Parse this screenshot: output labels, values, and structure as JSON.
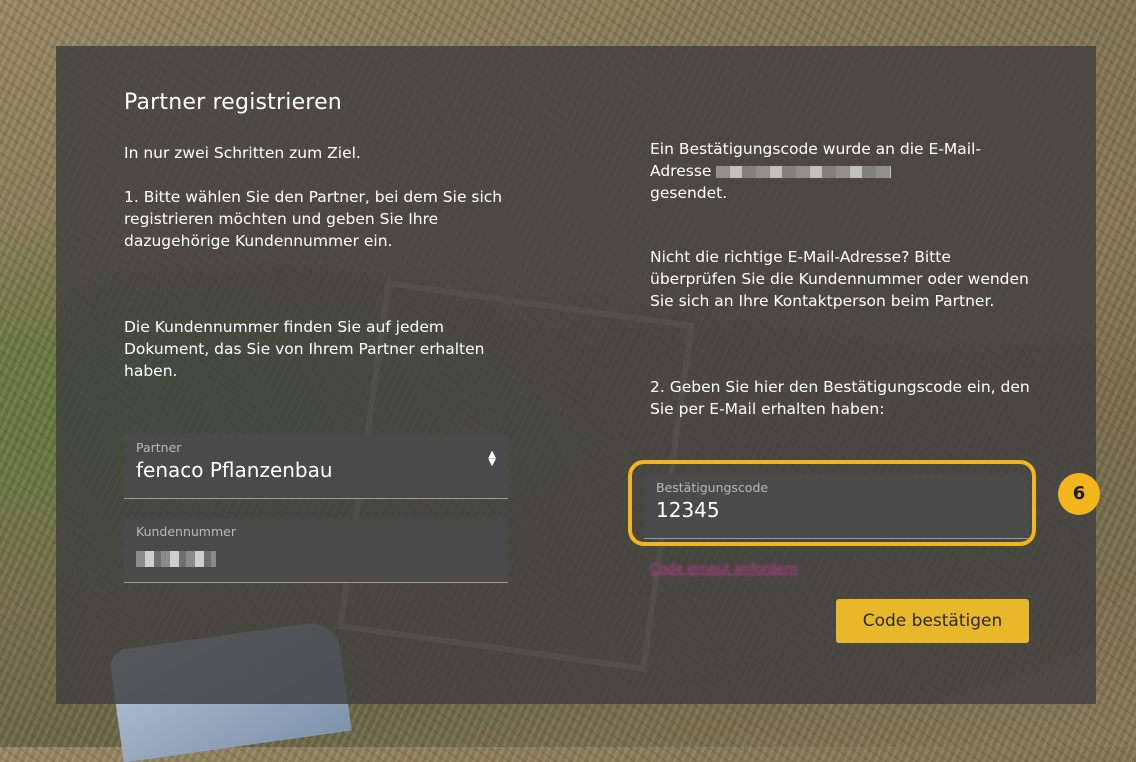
{
  "panel": {
    "title": "Partner registrieren",
    "subtitle": "In nur zwei Schritten zum Ziel.",
    "step1_text": "1. Bitte wählen Sie den Partner, bei dem Sie sich registrieren möchten und geben Sie Ihre dazugehörige Kundennummer ein.",
    "info_text": "Die Kundennummer finden Sie auf jedem Dokument, das Sie von Ihrem Partner erhalten haben."
  },
  "partner_select": {
    "label": "Partner",
    "value": "fenaco Pflanzenbau"
  },
  "customer_number": {
    "label": "Kundennummer"
  },
  "confirmation": {
    "sent_prefix": "Ein Bestätigungscode wurde an die E-Mail-Adresse",
    "sent_suffix": "gesendet.",
    "wrong_email_text": "Nicht die richtige E-Mail-Adresse? Bitte überprüfen Sie die Kundennummer oder wenden Sie sich an Ihre Kontaktperson beim Partner.",
    "step2_text": "2. Geben Sie hier den Bestätigungscode ein, den Sie per E-Mail erhalten haben:",
    "code_label": "Bestätigungscode",
    "code_value": "12345",
    "resend_link": "Code erneut anfordern",
    "confirm_button": "Code bestätigen"
  },
  "annotation": {
    "step_number": "6",
    "highlight_color": "#f2b51c"
  },
  "colors": {
    "panel_bg": "#404040",
    "button_bg": "#e8b72a",
    "link": "#c0398c"
  }
}
